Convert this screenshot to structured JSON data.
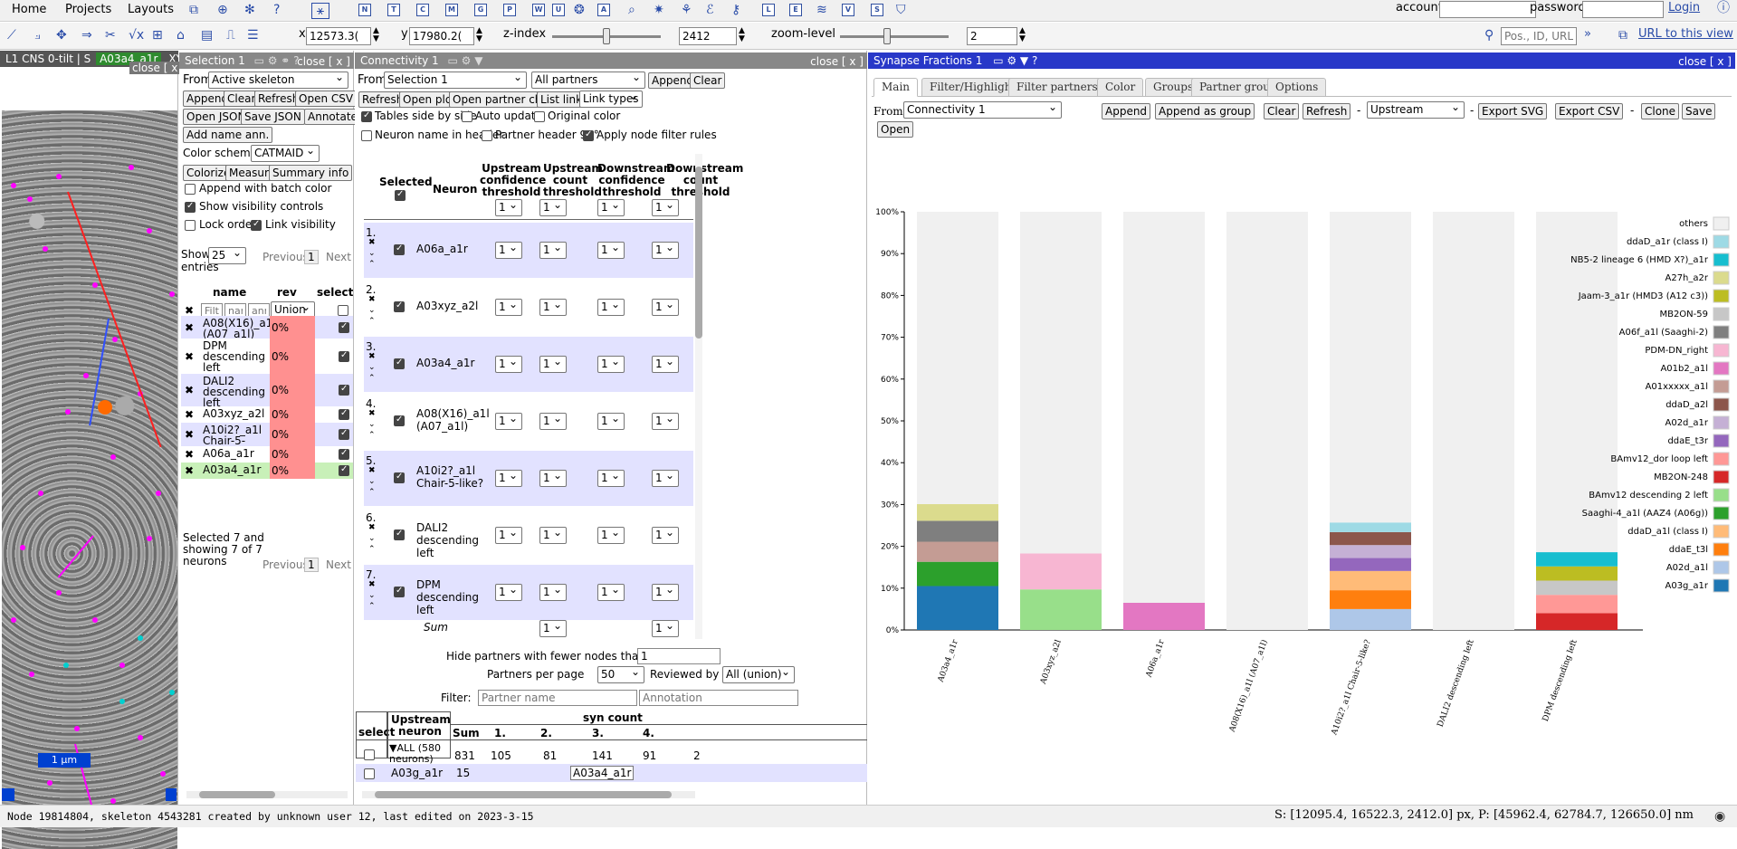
{
  "menubar": {
    "items": [
      "Home",
      "Projects",
      "Layouts"
    ],
    "account_label": "account",
    "password_label": "password",
    "login_label": "Login",
    "tool_letters": [
      "N",
      "T",
      "C",
      "M",
      "G",
      "P",
      "W",
      "U",
      "A",
      "L",
      "E",
      "N",
      "V",
      "S",
      "R"
    ]
  },
  "toolbar2": {
    "x_label": "x",
    "x_value": "12573.3(",
    "y_label": "y",
    "y_value": "17980.2(",
    "z_label": "z-index",
    "z_value": "2412",
    "zoom_label": "zoom-level",
    "zoom_value": "2",
    "pos_placeholder": "Pos., ID, URL",
    "url_link": "URL to this view"
  },
  "stack_viewer": {
    "title": "L1 CNS 0-tilt | S",
    "skeleton": "A03a4_a1r",
    "mode": "XY",
    "close": "close [ x ]",
    "scalebar": "1 µm"
  },
  "selection": {
    "title": "Selection 1",
    "close": "close [ x ]",
    "from_label": "From",
    "from_value": "Active skeleton",
    "buttons": [
      "Append",
      "Clear",
      "Refresh",
      "Open CSV",
      "Open JSON",
      "Save JSON",
      "Annotate",
      "Add name ann."
    ],
    "color_scheme_label": "Color scheme",
    "color_scheme_value": "CATMAID",
    "buttons2": [
      "Colorize",
      "Measure",
      "Summary info"
    ],
    "append_batch": "Append with batch color",
    "show_visibility": "Show visibility controls",
    "lock_order": "Lock order",
    "link_visibility": "Link visibility",
    "show_label": "Show",
    "show_value": "25",
    "entries": "entries",
    "previous": "Previous",
    "page": "1",
    "next": "Next",
    "col_name": "name",
    "col_rev": "rev",
    "col_selected": "selecte",
    "filter_placeholders": [
      "Filte",
      "nam",
      "anno"
    ],
    "union": "Union",
    "rows": [
      {
        "name": "A08(X16)_a1l (A07_a1l)",
        "rev": "0%"
      },
      {
        "name": "DPM descending left",
        "rev": "0%"
      },
      {
        "name": "DALI2 descending left",
        "rev": "0%"
      },
      {
        "name": "A03xyz_a2l",
        "rev": "0%"
      },
      {
        "name": "A10i2?_a1l Chair-5-like?",
        "rev": "0%"
      },
      {
        "name": "A06a_a1r",
        "rev": "0%"
      },
      {
        "name": "A03a4_a1r",
        "rev": "0%"
      }
    ],
    "summary": "Selected 7 and showing 7 of 7 neurons"
  },
  "connectivity": {
    "title": "Connectivity 1",
    "close": "close [ x ]",
    "from_label": "From",
    "from_value": "Selection 1",
    "partners_value": "All partners",
    "buttons": [
      "Append",
      "Clear",
      "Refresh",
      "Open plot",
      "Open partner chart",
      "List links"
    ],
    "link_types": "Link types",
    "opt_side": "Tables side by side",
    "opt_auto": "Auto update",
    "opt_color": "Original color",
    "opt_header": "Neuron name in header",
    "opt_90": "Partner header 90°",
    "opt_filter": "Apply node filter rules",
    "h_selected": "Selected",
    "h_neuron": "Neuron",
    "h_ucc": "Upstream confidence threshold",
    "h_uct": "Upstream count threshold",
    "h_dcc": "Downstream confidence threshold",
    "h_dct": "Downstream count threshold",
    "thr": "1",
    "rows": [
      {
        "idx": "1.",
        "name": "A06a_a1r"
      },
      {
        "idx": "2.",
        "name": "A03xyz_a2l"
      },
      {
        "idx": "3.",
        "name": "A03a4_a1r"
      },
      {
        "idx": "4.",
        "name": "A08(X16)_a1l (A07_a1l)"
      },
      {
        "idx": "5.",
        "name": "A10i2?_a1l Chair-5-like?"
      },
      {
        "idx": "6.",
        "name": "DALI2 descending left"
      },
      {
        "idx": "7.",
        "name": "DPM descending left"
      }
    ],
    "sum_label": "Sum",
    "hide_label": "Hide partners with fewer nodes than",
    "hide_value": "1",
    "per_page_label": "Partners per page",
    "per_page_value": "50",
    "reviewed_label": "Reviewed by",
    "reviewed_value": "All (union)",
    "filter_label": "Filter:",
    "filter_ph1": "Partner name",
    "filter_ph2": "Annotation",
    "t_select": "select",
    "t_upstream": "Upstream neuron",
    "t_syncount": "syn count",
    "t_sum": "Sum",
    "t_cols": [
      "1.",
      "2.",
      "3.",
      "4."
    ],
    "all_label": "ALL (580 neurons)",
    "all_values": [
      "831",
      "105",
      "81",
      "141",
      "91",
      "2"
    ],
    "row2_name": "A03g_a1r",
    "row2_sum": "15",
    "row2_tag": "A03a4_a1r"
  },
  "synapse": {
    "title": "Synapse Fractions 1",
    "close": "close [ x ]",
    "tabs": [
      "Main",
      "Filter/Highlight",
      "Filter partners",
      "Color",
      "Groups",
      "Partner groups",
      "Options"
    ],
    "from_label": "From",
    "from_value": "Connectivity 1",
    "buttons": [
      "Append",
      "Append as group",
      "Clear",
      "Refresh"
    ],
    "direction": "Upstream",
    "buttons2": [
      "Export SVG",
      "Export CSV",
      "Clone",
      "Save",
      "Open"
    ],
    "colors": {
      "others": "#f0f0f0",
      "ddaD_a1r": "#9edae5",
      "NB5_2": "#17becf",
      "A27h_a2r": "#dbdb8d",
      "Jaam3": "#bcbd22",
      "MB2ON59": "#c7c7c7",
      "A06f": "#7f7f7f",
      "PDM": "#f7b6d2",
      "A01b2": "#e377c2",
      "A01xxxxx": "#c49c94",
      "ddaD_a2l": "#8c564b",
      "A02d_a1r": "#c5b0d5",
      "ddaE_t3r": "#9467bd",
      "BAmv12dor": "#ff9896",
      "MB2ON248": "#d62728",
      "BAmv12desc": "#98df8a",
      "Saaghi4": "#2ca02c",
      "ddaD_a1l": "#ffbb78",
      "ddaE_t3l": "#ff7f0e",
      "A02d_a1l": "#aec7e8",
      "A03g_a1r": "#1f77b4"
    }
  },
  "chart_data": {
    "type": "bar",
    "stacked": true,
    "categories": [
      "A03a4_a1r",
      "A03xyz_a2l",
      "A06a_a1r",
      "A08(X16)_a1l (A07_a1l)",
      "A10i2?_a1l Chair-5-like?",
      "DALI2 descending left",
      "DPM descending left"
    ],
    "ylim": [
      0,
      100
    ],
    "yticks": [
      "0%",
      "10%",
      "20%",
      "30%",
      "40%",
      "50%",
      "60%",
      "70%",
      "80%",
      "90%",
      "100%"
    ],
    "legend": [
      "others",
      "ddaD_a1r (class I)",
      "NB5-2 lineage 6 (HMD X?)_a1r",
      "A27h_a2r",
      "Jaam-3_a1r (HMD3 (A12 c3))",
      "MB2ON-59",
      "A06f_a1l (Saaghi-2)",
      "PDM-DN_right",
      "A01b2_a1l",
      "A01xxxxx_a1l",
      "ddaD_a2l",
      "A02d_a1r",
      "ddaE_t3r",
      "BAmv12_dor loop left",
      "MB2ON-248",
      "BAmv12 descending 2 left",
      "Saaghi-4_a1l (AAZ4 (A06g))",
      "ddaD_a1l (class I)",
      "ddaE_t3l",
      "A02d_a1l",
      "A03g_a1r"
    ],
    "legend_colors": [
      "#f0f0f0",
      "#9edae5",
      "#17becf",
      "#dbdb8d",
      "#bcbd22",
      "#c7c7c7",
      "#7f7f7f",
      "#f7b6d2",
      "#e377c2",
      "#c49c94",
      "#8c564b",
      "#c5b0d5",
      "#9467bd",
      "#ff9896",
      "#d62728",
      "#98df8a",
      "#2ca02c",
      "#ffbb78",
      "#ff7f0e",
      "#aec7e8",
      "#1f77b4"
    ],
    "stacks": [
      [
        {
          "c": "#1f77b4",
          "v": 10.5
        },
        {
          "c": "#2ca02c",
          "v": 5.8
        },
        {
          "c": "#c49c94",
          "v": 4.8
        },
        {
          "c": "#7f7f7f",
          "v": 5.0
        },
        {
          "c": "#dbdb8d",
          "v": 4.0
        },
        {
          "c": "#f0f0f0",
          "v": 69.9
        }
      ],
      [
        {
          "c": "#98df8a",
          "v": 9.7
        },
        {
          "c": "#f7b6d2",
          "v": 8.6
        },
        {
          "c": "#f0f0f0",
          "v": 81.7
        }
      ],
      [
        {
          "c": "#e377c2",
          "v": 6.5
        },
        {
          "c": "#f0f0f0",
          "v": 93.5
        }
      ],
      [
        {
          "c": "#f0f0f0",
          "v": 100
        }
      ],
      [
        {
          "c": "#aec7e8",
          "v": 5.0
        },
        {
          "c": "#ff7f0e",
          "v": 4.5
        },
        {
          "c": "#ffbb78",
          "v": 4.6
        },
        {
          "c": "#9467bd",
          "v": 3.1
        },
        {
          "c": "#c5b0d5",
          "v": 3.1
        },
        {
          "c": "#8c564b",
          "v": 3.1
        },
        {
          "c": "#9edae5",
          "v": 2.3
        },
        {
          "c": "#f0f0f0",
          "v": 74.3
        }
      ],
      [
        {
          "c": "#f0f0f0",
          "v": 100
        }
      ],
      [
        {
          "c": "#d62728",
          "v": 4.0
        },
        {
          "c": "#ff9896",
          "v": 4.4
        },
        {
          "c": "#c7c7c7",
          "v": 3.4
        },
        {
          "c": "#bcbd22",
          "v": 3.4
        },
        {
          "c": "#17becf",
          "v": 3.4
        },
        {
          "c": "#f0f0f0",
          "v": 81.4
        }
      ]
    ]
  },
  "status": {
    "left": "Node 19814804, skeleton 4543281 created by unknown user 12, last edited on 2023-3-15",
    "right": "S: [12095.4, 16522.3, 2412.0] px, P: [45962.4, 62784.7, 126650.0] nm"
  }
}
